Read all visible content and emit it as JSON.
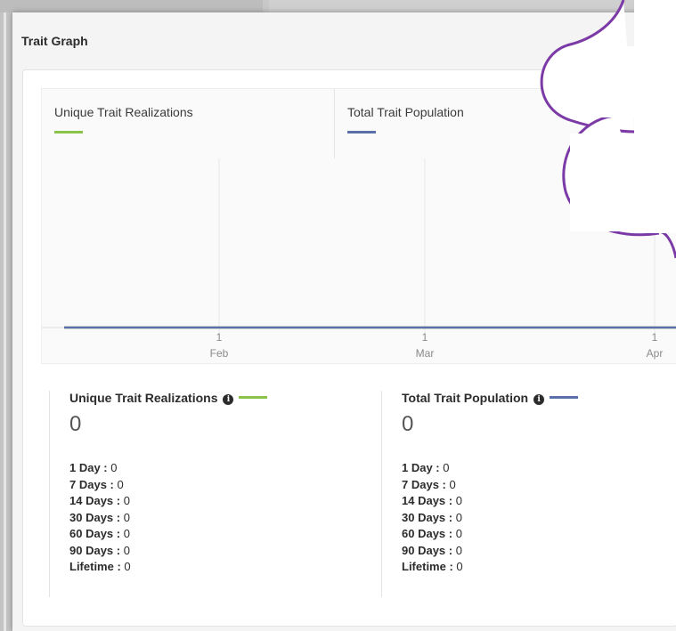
{
  "panel": {
    "title": "Trait Graph"
  },
  "colors": {
    "unique": "#8bc34a",
    "total": "#5b6fa8",
    "scribble": "#7b3aa6"
  },
  "legend": [
    {
      "label": "Unique Trait Realizations",
      "color": "#8bc34a"
    },
    {
      "label": "Total Trait Population",
      "color": "#5b6fa8"
    }
  ],
  "axis": {
    "ticks": [
      {
        "day": "1",
        "month": "Feb"
      },
      {
        "day": "1",
        "month": "Mar"
      },
      {
        "day": "1",
        "month": "Apr"
      }
    ]
  },
  "chart_data": {
    "type": "line",
    "x": [
      "1 Feb",
      "1 Mar",
      "1 Apr"
    ],
    "series": [
      {
        "name": "Unique Trait Realizations",
        "values": [
          0,
          0,
          0
        ]
      },
      {
        "name": "Total Trait Population",
        "values": [
          0,
          0,
          0
        ]
      }
    ]
  },
  "stats": [
    {
      "title": "Unique Trait Realizations",
      "info_icon": "info-icon",
      "total": "0",
      "rows": [
        {
          "label": "1 Day :",
          "value": "0"
        },
        {
          "label": "7 Days :",
          "value": "0"
        },
        {
          "label": "14 Days :",
          "value": "0"
        },
        {
          "label": "30 Days :",
          "value": "0"
        },
        {
          "label": "60 Days :",
          "value": "0"
        },
        {
          "label": "90 Days :",
          "value": "0"
        },
        {
          "label": "Lifetime :",
          "value": "0"
        }
      ]
    },
    {
      "title": "Total Trait Population",
      "info_icon": "info-icon",
      "total": "0",
      "rows": [
        {
          "label": "1 Day :",
          "value": "0"
        },
        {
          "label": "7 Days :",
          "value": "0"
        },
        {
          "label": "14 Days :",
          "value": "0"
        },
        {
          "label": "30 Days :",
          "value": "0"
        },
        {
          "label": "60 Days :",
          "value": "0"
        },
        {
          "label": "90 Days :",
          "value": "0"
        },
        {
          "label": "Lifetime :",
          "value": "0"
        }
      ]
    }
  ]
}
